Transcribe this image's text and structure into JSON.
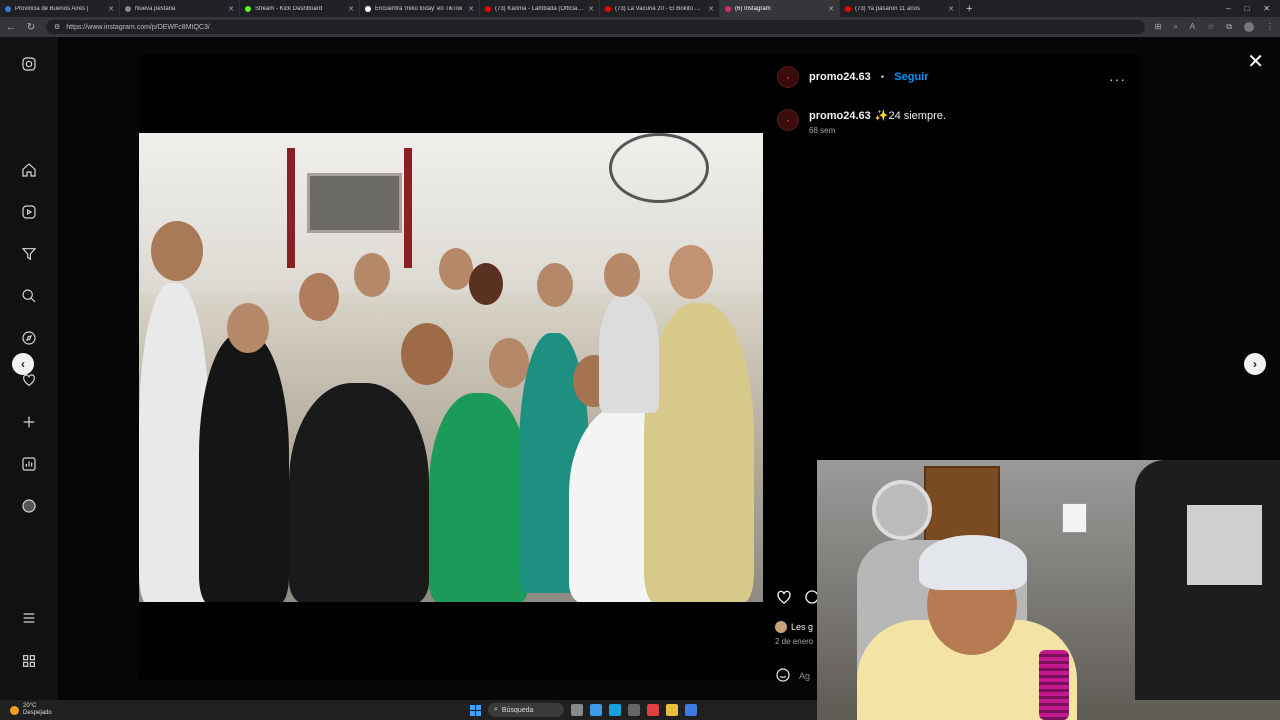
{
  "browser": {
    "tabs": [
      {
        "title": "Provincia de Buenos Aires |",
        "color": "#3b7bd4",
        "active": false
      },
      {
        "title": "Nueva pestaña",
        "color": "#888888",
        "active": false
      },
      {
        "title": "Stream - Kick Dashboard",
        "color": "#53fc18",
        "active": false
      },
      {
        "title": "Encuentra 'miku today' en TikTok",
        "color": "#ffffff",
        "active": false
      },
      {
        "title": "(73) Kaoma - Lambada (Official V",
        "color": "#ff0000",
        "active": false
      },
      {
        "title": "(73) La Vacuna 20 - El Bokito Ofic",
        "color": "#ff0000",
        "active": false
      },
      {
        "title": "(6) Instagram",
        "color": "#d62976",
        "active": true
      },
      {
        "title": "(73) Ya pasaron 11 años",
        "color": "#ff0000",
        "active": false
      }
    ],
    "new_tab_glyph": "+",
    "url": "https://www.instagram.com/p/DEWFc8MtQC3/"
  },
  "post": {
    "username": "promo24.63",
    "separator": "•",
    "follow_label": "Seguir",
    "more_glyph": "···",
    "caption_user": "promo24.63",
    "caption_text": "✨24 siempre.",
    "caption_time": "68 sem",
    "likes_text": "Les g",
    "date_text": "2 de enero",
    "comment_placeholder": "Ag"
  },
  "overlay": {
    "close_glyph": "✕",
    "prev_glyph": "‹",
    "next_glyph": "›"
  },
  "taskbar": {
    "temperature": "20°C",
    "weather_text": "Despejado",
    "search_label": "Búsqueda"
  },
  "icons": {
    "sidebar": [
      "instagram-icon",
      "home-icon",
      "reels-icon",
      "notifications-icon",
      "search-icon",
      "explore-icon",
      "heart-icon",
      "create-icon",
      "dashboard-icon",
      "profile-icon",
      "menu-icon",
      "apps-icon"
    ]
  }
}
